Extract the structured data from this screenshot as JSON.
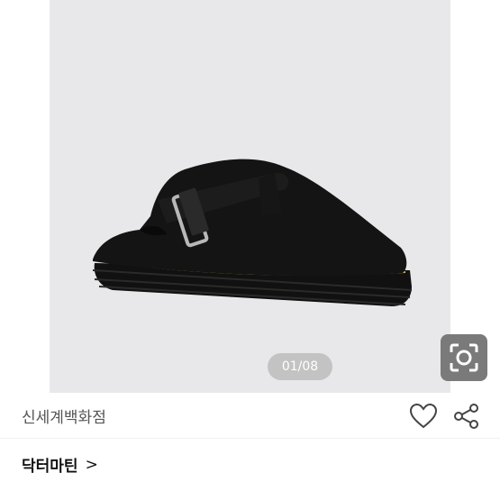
{
  "gallery": {
    "page_indicator": "01/08",
    "image_alt": "black suede buckle clog",
    "lens_icon": "image-search-icon"
  },
  "product": {
    "seller": "신세계백화점",
    "brand": "닥터마틴",
    "brand_chevron": ">",
    "wish_icon": "heart-icon",
    "share_icon": "share-icon"
  },
  "colors": {
    "gallery_bg": "#e8e8ea",
    "indicator_bg": "#969696",
    "lens_bg": "#7a7a7a"
  }
}
